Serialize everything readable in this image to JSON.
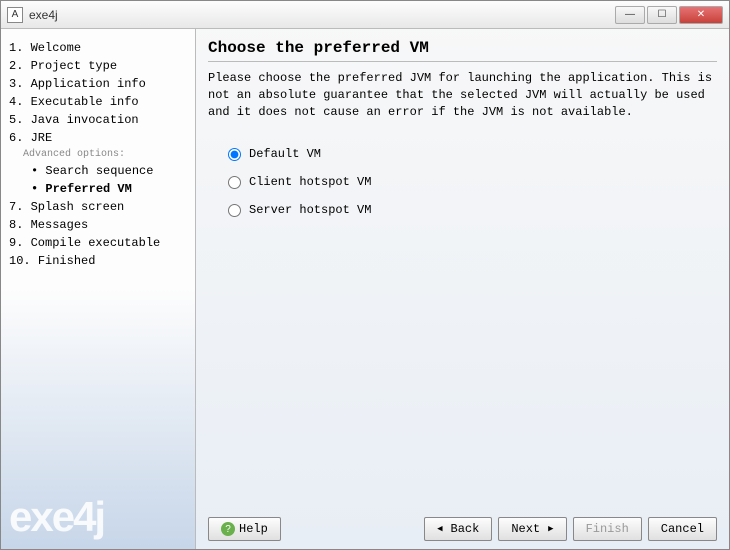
{
  "window": {
    "title": "exe4j"
  },
  "sidebar": {
    "steps": [
      "Welcome",
      "Project type",
      "Application info",
      "Executable info",
      "Java invocation",
      "JRE",
      "Splash screen",
      "Messages",
      "Compile executable",
      "Finished"
    ],
    "advancedHeader": "Advanced options:",
    "substeps": [
      "Search sequence",
      "Preferred VM"
    ],
    "currentSubstep": 1,
    "brand": "exe4j"
  },
  "main": {
    "title": "Choose the preferred VM",
    "description": "Please choose the preferred JVM for launching the application. This is not an absolute guarantee that the selected JVM will actually be used and it does not cause an error if the JVM is not available.",
    "options": [
      {
        "label": "Default VM",
        "selected": true
      },
      {
        "label": "Client hotspot VM",
        "selected": false
      },
      {
        "label": "Server hotspot VM",
        "selected": false
      }
    ]
  },
  "buttons": {
    "help": "Help",
    "back": "Back",
    "next": "Next",
    "finish": "Finish",
    "cancel": "Cancel"
  }
}
